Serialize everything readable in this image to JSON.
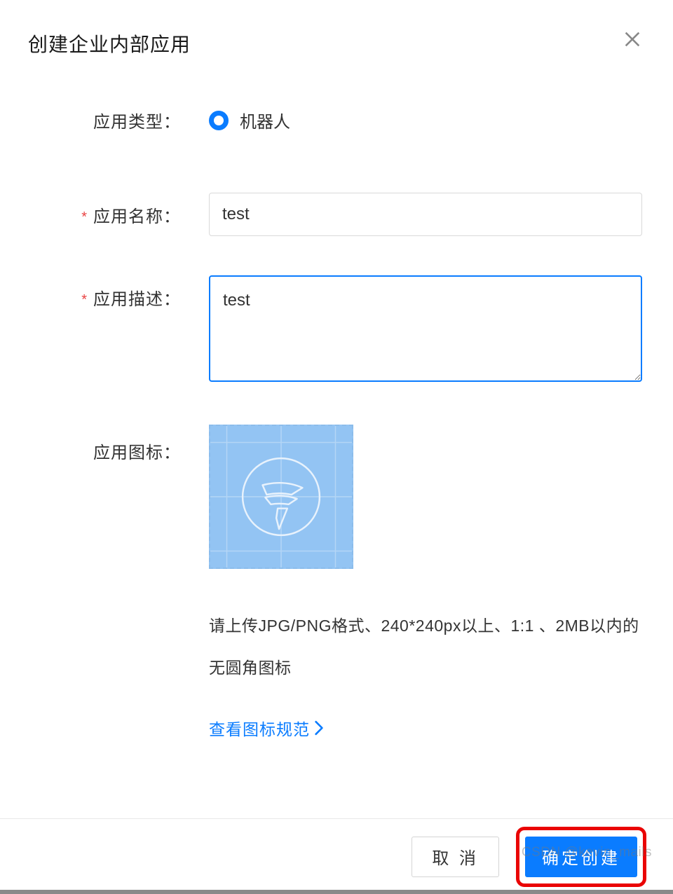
{
  "dialog": {
    "title": "创建企业内部应用"
  },
  "form": {
    "type": {
      "label": "应用类型：",
      "option": "机器人"
    },
    "name": {
      "label": "应用名称：",
      "value": "test"
    },
    "desc": {
      "label": "应用描述：",
      "value": "test"
    },
    "icon": {
      "label": "应用图标：",
      "hint": "请上传JPG/PNG格式、240*240px以上、1:1 、2MB以内的无圆角图标",
      "spec_link": "查看图标规范"
    }
  },
  "footer": {
    "cancel": "取 消",
    "confirm": "确定创建"
  },
  "watermark": "CSDN @kevin_mails"
}
